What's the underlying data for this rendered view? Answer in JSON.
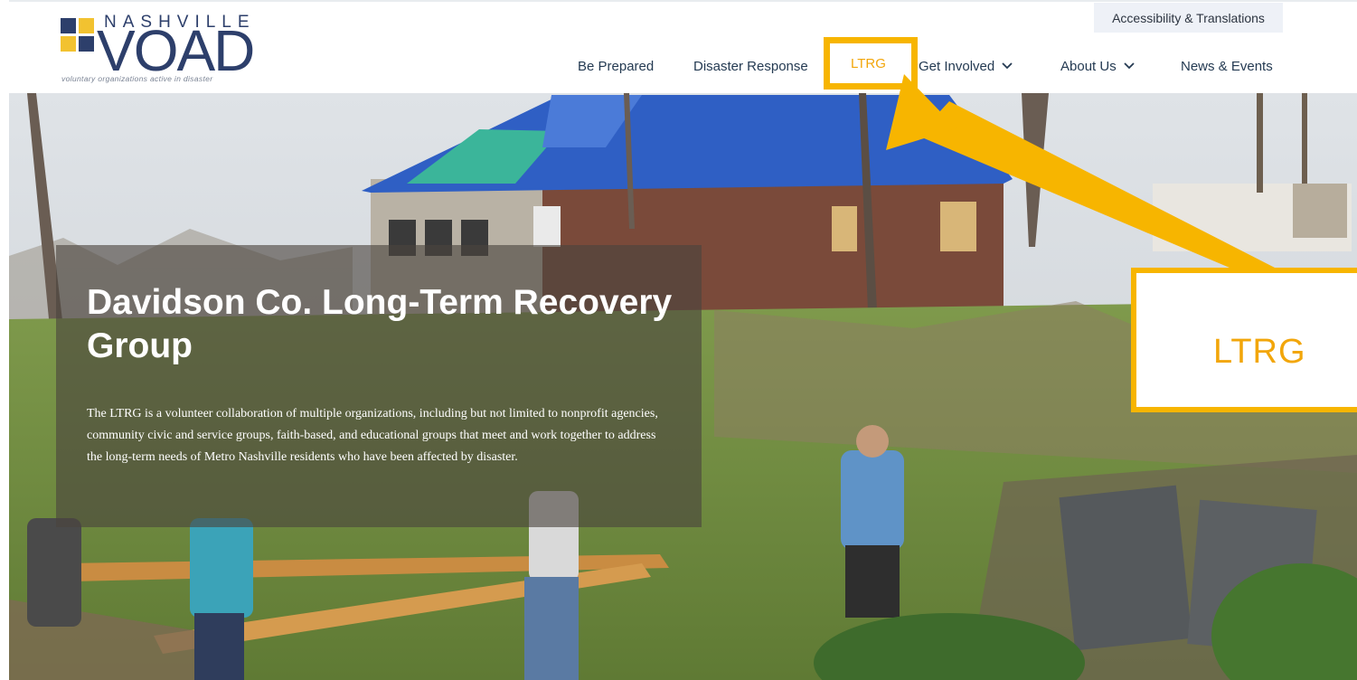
{
  "logo": {
    "name_small": "NASHVILLE",
    "name_large": "VOAD",
    "tagline": "voluntary organizations active in disaster",
    "square_colors": [
      "#2d3f6b",
      "#f2c230",
      "#f2c230",
      "#2d3f6b"
    ]
  },
  "utility": {
    "accessibility_label": "Accessibility & Translations"
  },
  "nav": {
    "items": [
      {
        "label": "Be Prepared"
      },
      {
        "label": "Disaster Response"
      },
      {
        "label": "LTRG"
      },
      {
        "label": "Get Involved"
      },
      {
        "label": "About Us"
      },
      {
        "label": "News & Events"
      }
    ]
  },
  "hero": {
    "title": "Davidson Co. Long-Term Recovery Group",
    "description": "The  LTRG is a volunteer collaboration of multiple organizations, including but not limited to nonprofit agencies, community civic and service groups, faith-based, and educational groups that meet and work together to address the long-term needs of Metro Nashville residents who have been affected by disaster."
  },
  "callout": {
    "zoom_label": "LTRG"
  },
  "colors": {
    "brand_navy": "#2d3f6b",
    "nav_text": "#243a52",
    "highlight": "#f7b500",
    "highlight_text": "#f2a60a"
  }
}
